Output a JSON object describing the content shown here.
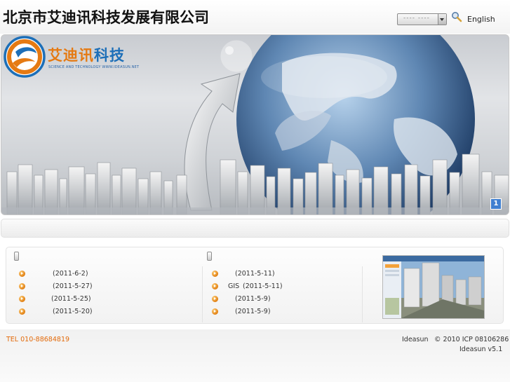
{
  "header": {
    "title": "北京市艾迪讯科技发展有限公司",
    "language_select": {
      "value": "---- ----"
    },
    "english_link": "English"
  },
  "banner": {
    "logo_main": "艾迪讯",
    "logo_accent": "科技",
    "logo_sub": "SCIENCE AND TECHNOLOGY WWW.IDEASUN.NET",
    "page_indicator": "1"
  },
  "news": {
    "left": [
      {
        "date": "(2011-6-2)"
      },
      {
        "date": "(2011-5-27)"
      },
      {
        "date": "(2011-5-25)"
      },
      {
        "date": "(2011-5-20)"
      }
    ],
    "right": [
      {
        "prefix": "",
        "date": "(2011-5-11)"
      },
      {
        "prefix": "GIS",
        "date": "(2011-5-11)"
      },
      {
        "prefix": "",
        "date": "(2011-5-9)"
      },
      {
        "prefix": "",
        "date": "(2011-5-9)"
      }
    ]
  },
  "footer": {
    "tel": "TEL 010-88684819",
    "company": "Ideasun",
    "icp": "© 2010 ICP 08106286",
    "version": "Ideasun v5.1"
  },
  "colors": {
    "accent": "#e36a0a",
    "logo_blue": "#1d6fb8",
    "badge": "#3f7fd0"
  }
}
